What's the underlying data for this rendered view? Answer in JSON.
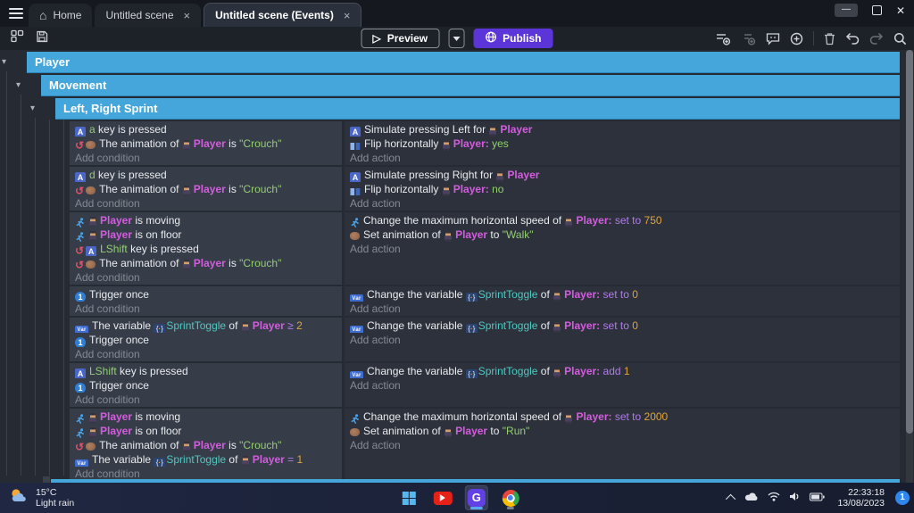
{
  "window": {
    "tabs": [
      {
        "label": "Home",
        "active": false,
        "closable": false
      },
      {
        "label": "Untitled scene",
        "active": false,
        "closable": true
      },
      {
        "label": "Untitled scene (Events)",
        "active": true,
        "closable": true
      }
    ]
  },
  "toolbar": {
    "preview_label": "Preview",
    "publish_label": "Publish",
    "right_icons": [
      "add-event-icon",
      "add-subevent-icon",
      "add-comment-icon",
      "circle-add-icon",
      "delete-icon",
      "undo-icon",
      "redo-icon",
      "search-icon"
    ],
    "left_icons": [
      "panels-icon",
      "save-icon"
    ]
  },
  "groups": [
    "Player",
    "Movement",
    "Left, Right Sprint"
  ],
  "labels": {
    "add_condition": "Add condition",
    "add_action": "Add action"
  },
  "events": [
    {
      "conditions": [
        [
          {
            "i": "keyboard-icon"
          },
          {
            "s": "a",
            "c": "g"
          },
          {
            "s": " key is pressed"
          }
        ],
        [
          {
            "i": "invert-icon"
          },
          {
            "i": "animation-icon"
          },
          {
            "s": "The animation of "
          },
          {
            "i": "player-icon"
          },
          {
            "s": "Player",
            "c": "o"
          },
          {
            "s": " is "
          },
          {
            "s": "\"Crouch\"",
            "c": "g"
          }
        ]
      ],
      "actions": [
        [
          {
            "i": "keyboard-icon"
          },
          {
            "s": "Simulate pressing Left for "
          },
          {
            "i": "player-icon"
          },
          {
            "s": "Player",
            "c": "o"
          }
        ],
        [
          {
            "i": "flip-icon"
          },
          {
            "s": "Flip horizontally "
          },
          {
            "i": "player-icon"
          },
          {
            "s": "Player:",
            "c": "o"
          },
          {
            "s": " yes",
            "c": "g"
          }
        ]
      ]
    },
    {
      "conditions": [
        [
          {
            "i": "keyboard-icon"
          },
          {
            "s": "d",
            "c": "g"
          },
          {
            "s": " key is pressed"
          }
        ],
        [
          {
            "i": "invert-icon"
          },
          {
            "i": "animation-icon"
          },
          {
            "s": "The animation of "
          },
          {
            "i": "player-icon"
          },
          {
            "s": "Player",
            "c": "o"
          },
          {
            "s": " is "
          },
          {
            "s": "\"Crouch\"",
            "c": "g"
          }
        ]
      ],
      "actions": [
        [
          {
            "i": "keyboard-icon"
          },
          {
            "s": "Simulate pressing Right for "
          },
          {
            "i": "player-icon"
          },
          {
            "s": "Player",
            "c": "o"
          }
        ],
        [
          {
            "i": "flip-icon"
          },
          {
            "s": "Flip horizontally "
          },
          {
            "i": "player-icon"
          },
          {
            "s": "Player:",
            "c": "o"
          },
          {
            "s": " no",
            "c": "g"
          }
        ]
      ]
    },
    {
      "conditions": [
        [
          {
            "i": "platformer-icon"
          },
          {
            "i": "player-icon"
          },
          {
            "s": "Player",
            "c": "o"
          },
          {
            "s": " is moving"
          }
        ],
        [
          {
            "i": "platformer-icon"
          },
          {
            "i": "player-icon"
          },
          {
            "s": "Player",
            "c": "o"
          },
          {
            "s": " is on floor"
          }
        ],
        [
          {
            "i": "invert-icon"
          },
          {
            "i": "keyboard-icon"
          },
          {
            "s": "LShift",
            "c": "g"
          },
          {
            "s": " key is pressed"
          }
        ],
        [
          {
            "i": "invert-icon"
          },
          {
            "i": "animation-icon"
          },
          {
            "s": "The animation of "
          },
          {
            "i": "player-icon"
          },
          {
            "s": "Player",
            "c": "o"
          },
          {
            "s": " is "
          },
          {
            "s": "\"Crouch\"",
            "c": "g"
          }
        ]
      ],
      "actions": [
        [
          {
            "i": "platformer-icon"
          },
          {
            "s": "Change the maximum horizontal speed of "
          },
          {
            "i": "player-icon"
          },
          {
            "s": "Player:",
            "c": "o"
          },
          {
            "s": " set to ",
            "c": "p"
          },
          {
            "s": "750",
            "c": "n"
          }
        ],
        [
          {
            "i": "animation-icon"
          },
          {
            "s": "Set animation of "
          },
          {
            "i": "player-icon"
          },
          {
            "s": "Player",
            "c": "o"
          },
          {
            "s": " to "
          },
          {
            "s": "\"Walk\"",
            "c": "g"
          }
        ]
      ]
    },
    {
      "conditions": [
        [
          {
            "i": "trigger-once-icon"
          },
          {
            "s": "Trigger once"
          }
        ]
      ],
      "actions": [
        [
          {
            "i": "variable-icon"
          },
          {
            "s": "Change the variable "
          },
          {
            "i": "braces-icon"
          },
          {
            "s": "SprintToggle",
            "c": "v"
          },
          {
            "s": " of "
          },
          {
            "i": "player-icon"
          },
          {
            "s": "Player:",
            "c": "o"
          },
          {
            "s": " set to ",
            "c": "p"
          },
          {
            "s": "0",
            "c": "n"
          }
        ]
      ]
    },
    {
      "conditions": [
        [
          {
            "i": "variable-icon"
          },
          {
            "s": "The variable "
          },
          {
            "i": "braces-icon"
          },
          {
            "s": "SprintToggle",
            "c": "v"
          },
          {
            "s": " of "
          },
          {
            "i": "player-icon"
          },
          {
            "s": "Player",
            "c": "o"
          },
          {
            "s": " ≥ ",
            "c": "p"
          },
          {
            "s": "2",
            "c": "n"
          }
        ],
        [
          {
            "i": "trigger-once-icon"
          },
          {
            "s": "Trigger once"
          }
        ]
      ],
      "actions": [
        [
          {
            "i": "variable-icon"
          },
          {
            "s": "Change the variable "
          },
          {
            "i": "braces-icon"
          },
          {
            "s": "SprintToggle",
            "c": "v"
          },
          {
            "s": " of "
          },
          {
            "i": "player-icon"
          },
          {
            "s": "Player:",
            "c": "o"
          },
          {
            "s": " set to ",
            "c": "p"
          },
          {
            "s": "0",
            "c": "n"
          }
        ]
      ]
    },
    {
      "conditions": [
        [
          {
            "i": "keyboard-icon"
          },
          {
            "s": "LShift",
            "c": "g"
          },
          {
            "s": " key is pressed"
          }
        ],
        [
          {
            "i": "trigger-once-icon"
          },
          {
            "s": "Trigger once"
          }
        ]
      ],
      "actions": [
        [
          {
            "i": "variable-icon"
          },
          {
            "s": "Change the variable "
          },
          {
            "i": "braces-icon"
          },
          {
            "s": "SprintToggle",
            "c": "v"
          },
          {
            "s": " of "
          },
          {
            "i": "player-icon"
          },
          {
            "s": "Player:",
            "c": "o"
          },
          {
            "s": " add ",
            "c": "p"
          },
          {
            "s": "1",
            "c": "n"
          }
        ]
      ]
    },
    {
      "conditions": [
        [
          {
            "i": "platformer-icon"
          },
          {
            "i": "player-icon"
          },
          {
            "s": "Player",
            "c": "o"
          },
          {
            "s": " is moving"
          }
        ],
        [
          {
            "i": "platformer-icon"
          },
          {
            "i": "player-icon"
          },
          {
            "s": "Player",
            "c": "o"
          },
          {
            "s": " is on floor"
          }
        ],
        [
          {
            "i": "invert-icon"
          },
          {
            "i": "animation-icon"
          },
          {
            "s": "The animation of "
          },
          {
            "i": "player-icon"
          },
          {
            "s": "Player",
            "c": "o"
          },
          {
            "s": " is "
          },
          {
            "s": "\"Crouch\"",
            "c": "g"
          }
        ],
        [
          {
            "i": "variable-icon"
          },
          {
            "s": "The variable "
          },
          {
            "i": "braces-icon"
          },
          {
            "s": "SprintToggle",
            "c": "v"
          },
          {
            "s": " of "
          },
          {
            "i": "player-icon"
          },
          {
            "s": "Player",
            "c": "o"
          },
          {
            "s": " = ",
            "c": "p"
          },
          {
            "s": "1",
            "c": "n"
          }
        ]
      ],
      "actions": [
        [
          {
            "i": "platformer-icon"
          },
          {
            "s": "Change the maximum horizontal speed of "
          },
          {
            "i": "player-icon"
          },
          {
            "s": "Player:",
            "c": "o"
          },
          {
            "s": " set to ",
            "c": "p"
          },
          {
            "s": "2000",
            "c": "n"
          }
        ],
        [
          {
            "i": "animation-icon"
          },
          {
            "s": "Set animation of "
          },
          {
            "i": "player-icon"
          },
          {
            "s": "Player",
            "c": "o"
          },
          {
            "s": " to "
          },
          {
            "s": "\"Run\"",
            "c": "g"
          }
        ]
      ]
    }
  ],
  "taskbar": {
    "weather_temp": "15°C",
    "weather_desc": "Light rain",
    "time": "22:33:18",
    "date": "13/08/2023",
    "notification_badge": "1",
    "app_icons": [
      "windows-start-icon",
      "youtube-icon",
      "gdevelop-icon",
      "chrome-icon"
    ],
    "tray_icons": [
      "chevron-up-icon",
      "cloud-icon",
      "wifi-icon",
      "speaker-icon",
      "battery-icon"
    ]
  },
  "colors": {
    "group_bar": "#44a6db",
    "publish_button": "#5b35d8",
    "object_text": "#d45ddf",
    "string_text": "#93ce72",
    "variable_text": "#4fc8c3",
    "operator_text": "#b07ce8",
    "number_text": "#dfa440"
  }
}
